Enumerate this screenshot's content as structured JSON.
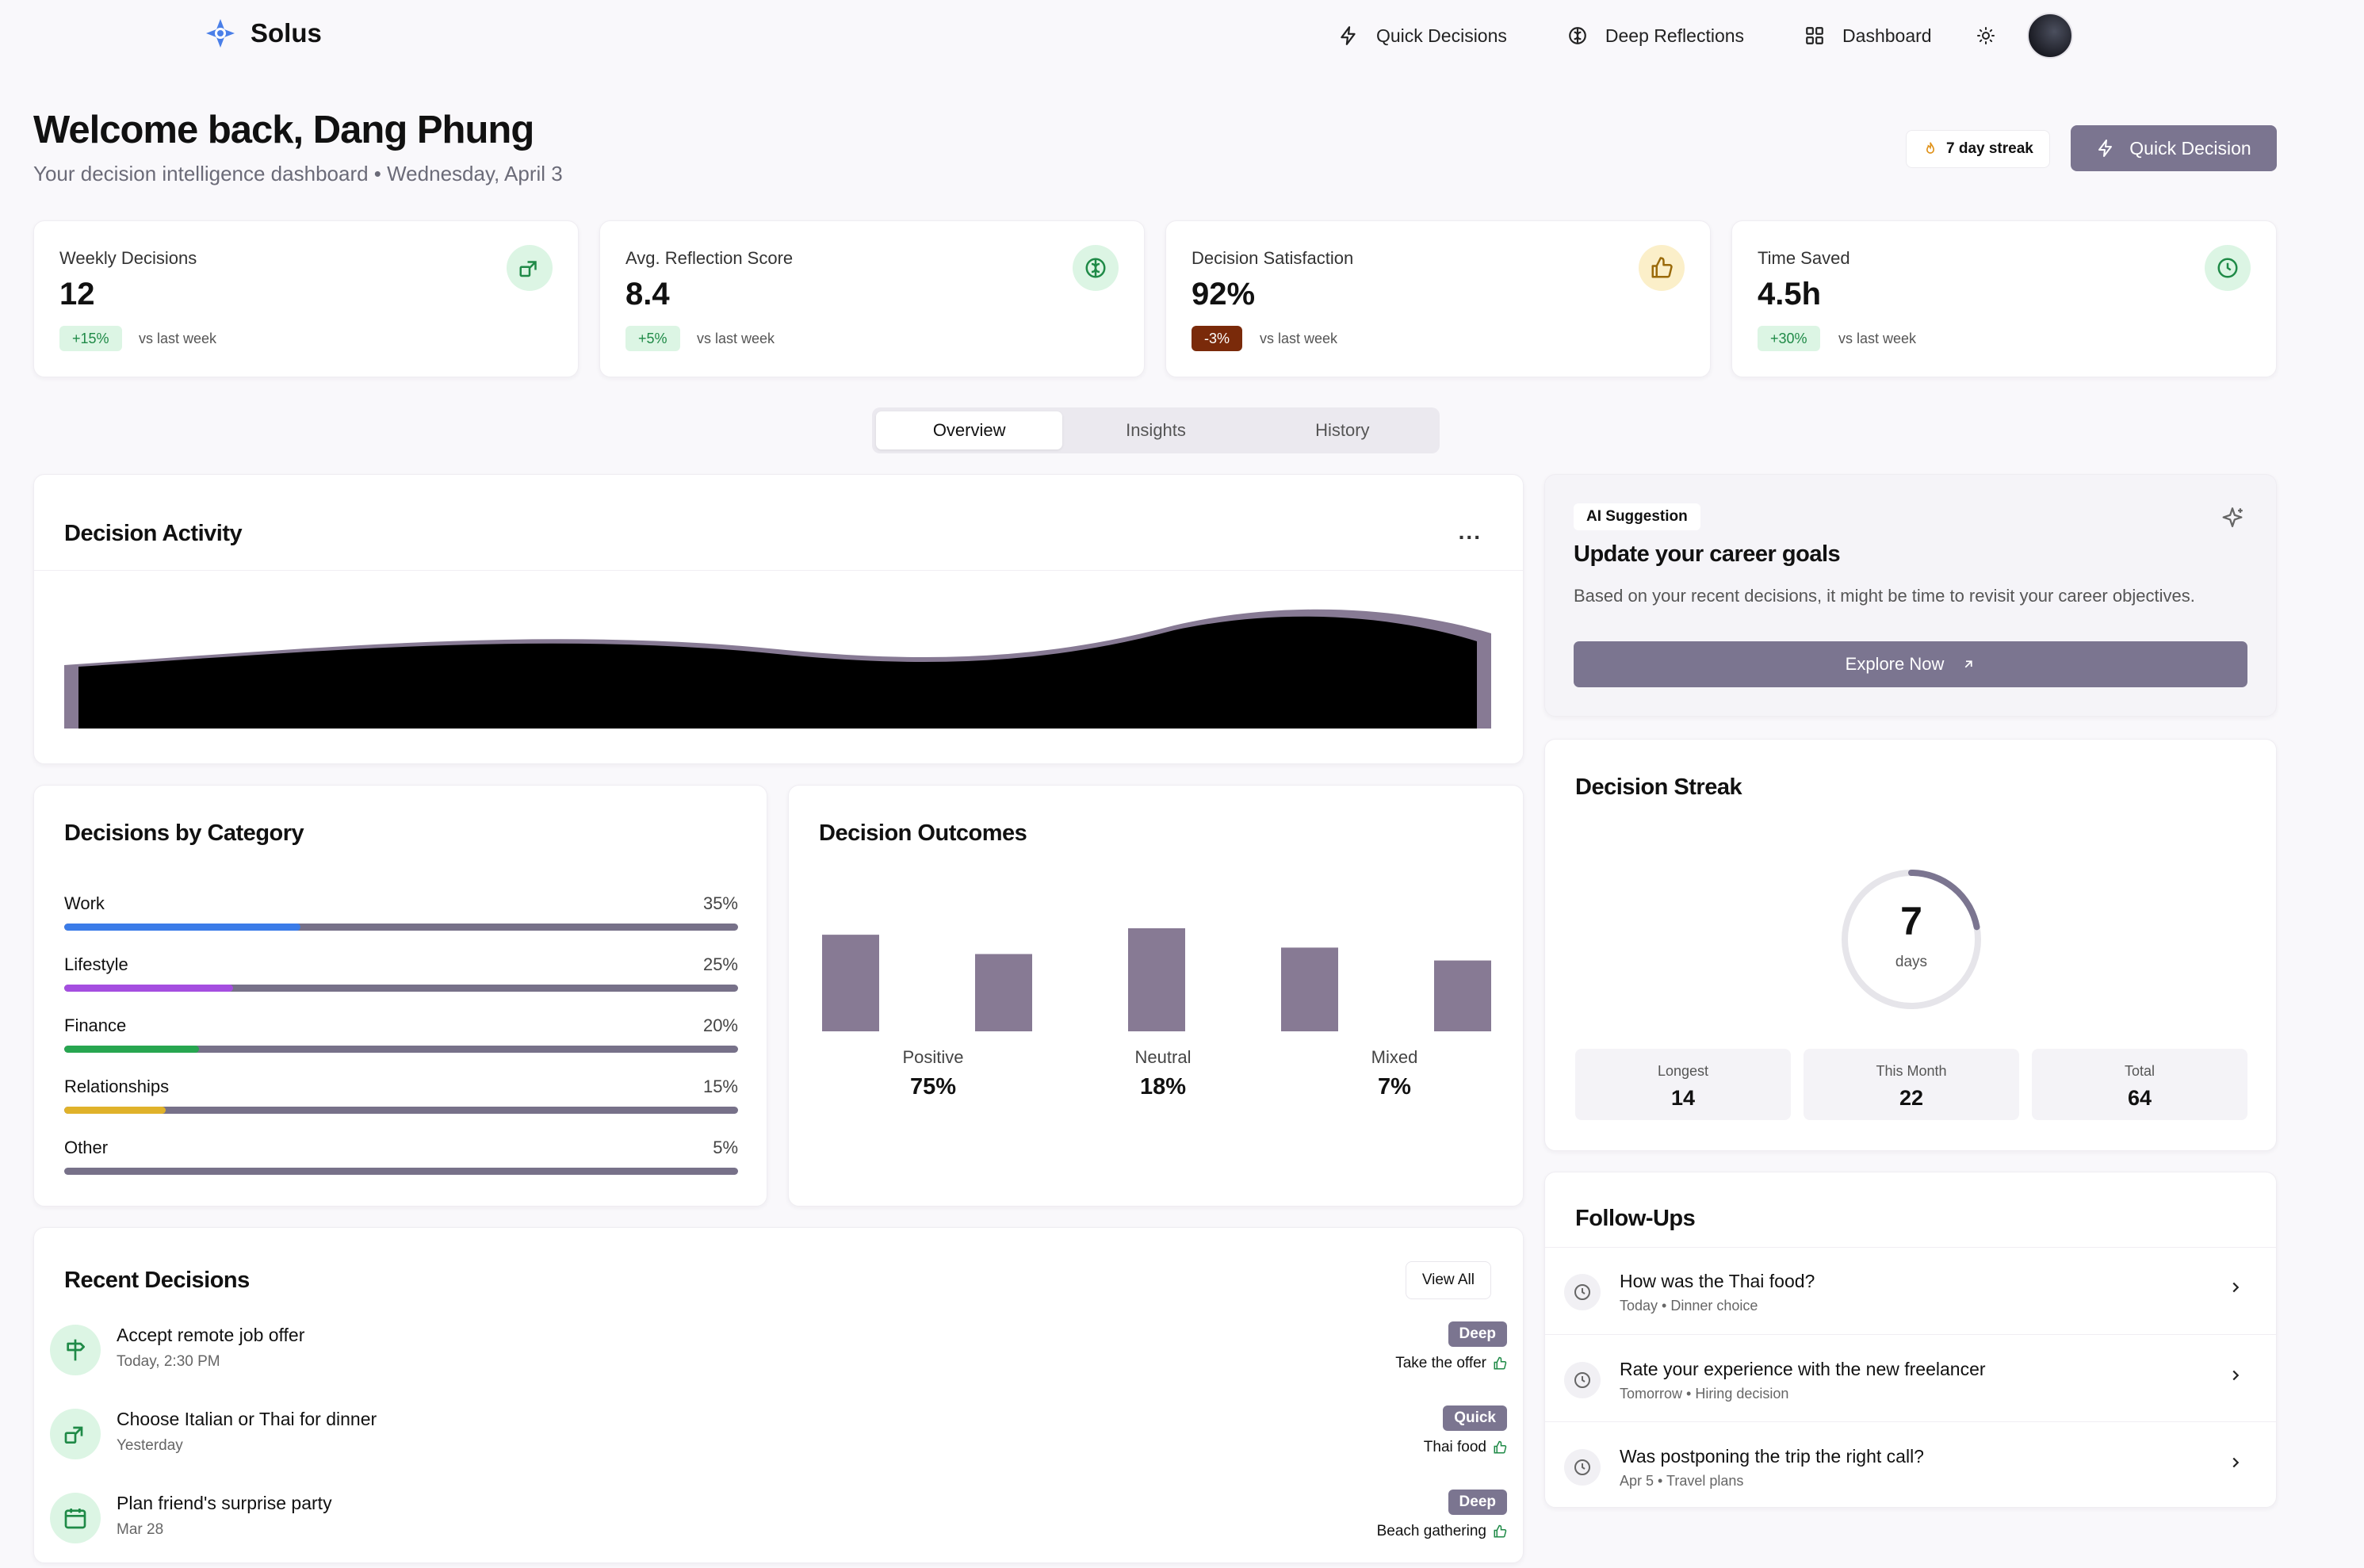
{
  "app": {
    "name": "Solus"
  },
  "nav": {
    "quick_decisions": "Quick Decisions",
    "deep_reflections": "Deep Reflections",
    "dashboard": "Dashboard"
  },
  "welcome": {
    "title": "Welcome back, Dang Phung",
    "subtitle": "Your decision intelligence dashboard • Wednesday, April 3",
    "streak": "7 day streak",
    "quick_decision": "Quick Decision"
  },
  "stats": [
    {
      "label": "Weekly Decisions",
      "value": "12",
      "delta": "+15%",
      "vs": "vs last week",
      "icon": "decision-icon"
    },
    {
      "label": "Avg. Reflection Score",
      "value": "8.4",
      "delta": "+5%",
      "vs": "vs last week",
      "icon": "brain-icon"
    },
    {
      "label": "Decision Satisfaction",
      "value": "92%",
      "delta": "-3%",
      "vs": "vs last week",
      "icon": "thumbs-up-icon"
    },
    {
      "label": "Time Saved",
      "value": "4.5h",
      "delta": "+30%",
      "vs": "vs last week",
      "icon": "clock-icon"
    }
  ],
  "tabs": [
    "Overview",
    "Insights",
    "History"
  ],
  "activity": {
    "title": "Decision Activity",
    "menu": "..."
  },
  "category": {
    "title": "Decisions by Category",
    "items": [
      {
        "name": "Work",
        "pct": "35%",
        "value": 35,
        "color": "#3b7ce8"
      },
      {
        "name": "Lifestyle",
        "pct": "25%",
        "value": 25,
        "color": "#a54ee0"
      },
      {
        "name": "Finance",
        "pct": "20%",
        "value": 20,
        "color": "#27a650"
      },
      {
        "name": "Relationships",
        "pct": "15%",
        "value": 15,
        "color": "#e0b22a"
      },
      {
        "name": "Other",
        "pct": "5%",
        "value": 5,
        "color": "#777189"
      }
    ]
  },
  "outcomes": {
    "title": "Decision Outcomes",
    "bars": [
      60,
      48,
      64,
      52,
      44
    ],
    "items": [
      {
        "label": "Positive",
        "value": "75%"
      },
      {
        "label": "Neutral",
        "value": "18%"
      },
      {
        "label": "Mixed",
        "value": "7%"
      }
    ]
  },
  "recent": {
    "title": "Recent Decisions",
    "view_all": "View All",
    "items": [
      {
        "title": "Accept remote job offer",
        "time": "Today, 2:30 PM",
        "badge": "Deep",
        "result": "Take the offer",
        "icon": "signpost-icon"
      },
      {
        "title": "Choose Italian or Thai for dinner",
        "time": "Yesterday",
        "badge": "Quick",
        "result": "Thai food",
        "icon": "decision-icon"
      },
      {
        "title": "Plan friend's surprise party",
        "time": "Mar 28",
        "badge": "Deep",
        "result": "Beach gathering",
        "icon": "calendar-icon"
      }
    ]
  },
  "ai": {
    "tag": "AI Suggestion",
    "title": "Update your career goals",
    "desc": "Based on your recent decisions, it might be time to revisit your career objectives.",
    "button": "Explore Now"
  },
  "streak": {
    "title": "Decision Streak",
    "value": "7",
    "unit": "days",
    "progress": 0.22,
    "boxes": [
      {
        "label": "Longest",
        "value": "14"
      },
      {
        "label": "This Month",
        "value": "22"
      },
      {
        "label": "Total",
        "value": "64"
      }
    ]
  },
  "followups": {
    "title": "Follow-Ups",
    "items": [
      {
        "title": "How was the Thai food?",
        "sub": "Today • Dinner choice"
      },
      {
        "title": "Rate your experience with the new freelancer",
        "sub": "Tomorrow • Hiring decision"
      },
      {
        "title": "Was postponing the trip the right call?",
        "sub": "Apr 5 • Travel plans"
      }
    ]
  },
  "colors": {
    "accent": "#7b7590",
    "bar": "#877a94",
    "green": "#1f8a47"
  }
}
